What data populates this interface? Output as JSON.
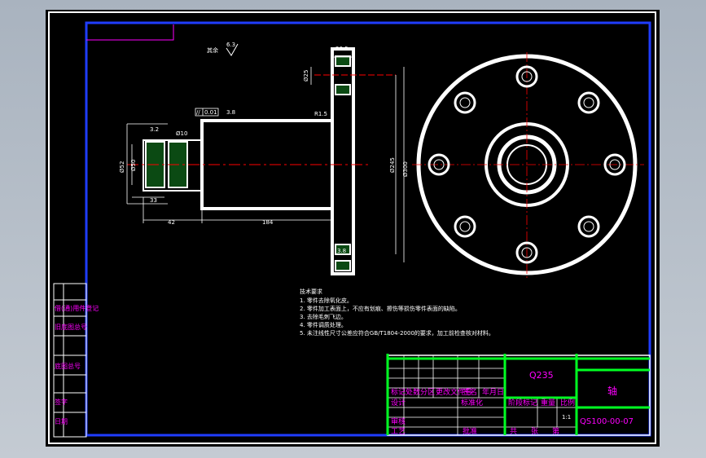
{
  "drawing": {
    "surface_note_prefix": "其余",
    "surface_note_value": "6.3",
    "tolerance_symbol": "//",
    "tolerance_value": "0.01",
    "dims": {
      "d_265": "26.5",
      "d_25": "Ø25",
      "d_r15": "R1.5",
      "d_32": "3.2",
      "d_phi10": "Ø10",
      "d_38": "3.8",
      "d_phi50": "Ø50",
      "d_phi52": "Ø52",
      "d_33": "33",
      "d_42": "42",
      "d_184": "184",
      "d_phi245": "Ø245",
      "d_phi300": "Ø300",
      "d_38b": "3.8"
    }
  },
  "notes": {
    "title": "技术要求",
    "items": [
      "1. 零件去除氧化皮。",
      "2. 零件加工表面上，不应有划痕、擦伤等损伤零件表面的缺陷。",
      "3. 去除毛刺飞边。",
      "4. 零件调质处理。",
      "5. 未注线性尺寸公差应符合GB/T1804-2000的要求，加工前检查核对材料。"
    ]
  },
  "side_labels": [
    "借(通)用件登记",
    "旧底图总号",
    "底图总号",
    "签字",
    "日期"
  ],
  "title_block": {
    "material": "Q235",
    "part_name": "轴",
    "drawing_no": "QS100-00-07",
    "header_cells": [
      "标记",
      "处数",
      "分区",
      "更改文件号",
      "签名",
      "年月日"
    ],
    "role_rows": [
      "设计",
      "审核",
      "工艺"
    ],
    "standardization": "标准化",
    "approve": "批准",
    "stage_mark": "阶段标记",
    "weight": "重量",
    "scale": "比例",
    "scale_value": "1:1",
    "sheet_total": "共",
    "sheet_unit": "张",
    "sheet_no": "第"
  }
}
